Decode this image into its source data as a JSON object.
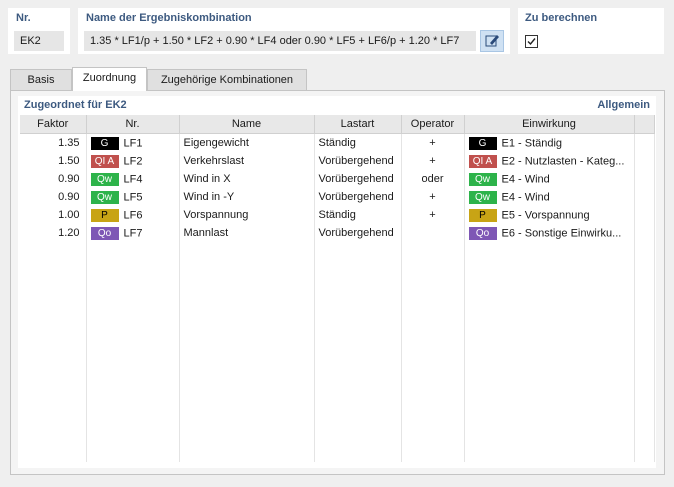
{
  "header": {
    "nr_label": "Nr.",
    "nr_value": "EK2",
    "name_label": "Name der Ergebniskombination",
    "name_value": "1.35 * LF1/p + 1.50 * LF2 + 0.90 * LF4 oder 0.90 * LF5 + LF6/p + 1.20 * LF7",
    "calc_label": "Zu berechnen",
    "calc_checked": true
  },
  "tabs": [
    "Basis",
    "Zuordnung",
    "Zugehörige Kombinationen"
  ],
  "active_tab": "Zuordnung",
  "section": {
    "title": "Zugeordnet für EK2",
    "link": "Allgemein"
  },
  "columns": [
    "Faktor",
    "Nr.",
    "Name",
    "Lastart",
    "Operator",
    "Einwirkung"
  ],
  "rows": [
    {
      "faktor": "1.35",
      "badge": "G",
      "badge_color": "#000000",
      "nr": "LF1",
      "name": "Eigengewicht",
      "lastart": "Ständig",
      "operator": "+",
      "e_badge": "G",
      "e_color": "#000000",
      "einwirkung": "E1 - Ständig"
    },
    {
      "faktor": "1.50",
      "badge": "QI A",
      "badge_color": "#c0504d",
      "nr": "LF2",
      "name": "Verkehrslast",
      "lastart": "Vorübergehend",
      "operator": "+",
      "e_badge": "QI A",
      "e_color": "#c0504d",
      "einwirkung": "E2 - Nutzlasten - Kateg..."
    },
    {
      "faktor": "0.90",
      "badge": "Qw",
      "badge_color": "#2db34a",
      "nr": "LF4",
      "name": "Wind in X",
      "lastart": "Vorübergehend",
      "operator": "oder",
      "e_badge": "Qw",
      "e_color": "#2db34a",
      "einwirkung": "E4 - Wind"
    },
    {
      "faktor": "0.90",
      "badge": "Qw",
      "badge_color": "#2db34a",
      "nr": "LF5",
      "name": "Wind in -Y",
      "lastart": "Vorübergehend",
      "operator": "+",
      "e_badge": "Qw",
      "e_color": "#2db34a",
      "einwirkung": "E4 - Wind"
    },
    {
      "faktor": "1.00",
      "badge": "P",
      "badge_color": "#c8a415",
      "nr": "LF6",
      "name": "Vorspannung",
      "lastart": "Ständig",
      "operator": "+",
      "e_badge": "P",
      "e_color": "#c8a415",
      "einwirkung": "E5 - Vorspannung"
    },
    {
      "faktor": "1.20",
      "badge": "Qo",
      "badge_color": "#7e57b5",
      "nr": "LF7",
      "name": "Mannlast",
      "lastart": "Vorübergehend",
      "operator": "",
      "e_badge": "Qo",
      "e_color": "#7e57b5",
      "einwirkung": "E6 - Sonstige Einwirku..."
    }
  ]
}
